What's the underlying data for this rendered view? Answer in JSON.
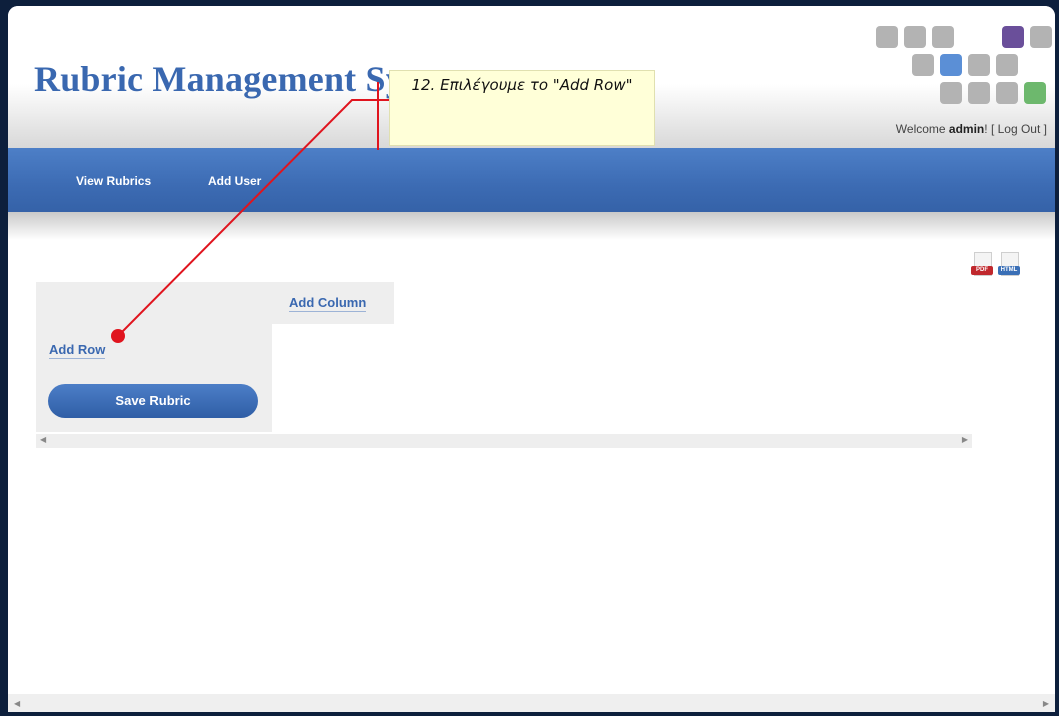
{
  "header": {
    "title": "Rubric Management System",
    "welcome_prefix": "Welcome",
    "username": "admin",
    "welcome_suffix": "!",
    "logout_label": "[ Log Out ]"
  },
  "nav": {
    "items": [
      {
        "label": "View Rubrics"
      },
      {
        "label": "Add User"
      }
    ]
  },
  "export": {
    "pdf_label": "PDF",
    "html_label": "HTML"
  },
  "rubric_table": {
    "add_column_label": "Add Column",
    "add_row_label": "Add Row",
    "save_label": "Save Rubric"
  },
  "callout": {
    "text": "12. Επιλέγουμε το \"Add Row\""
  },
  "colors": {
    "brand_blue": "#3a68b0",
    "nav_blue": "#3c6bb3",
    "callout_bg": "#ffffd8",
    "pointer_red": "#e0141e",
    "tile_gray": "#b3b3b3",
    "tile_purple": "#6a4f9a",
    "tile_blue": "#5b8fd6",
    "tile_green": "#6db86d"
  }
}
